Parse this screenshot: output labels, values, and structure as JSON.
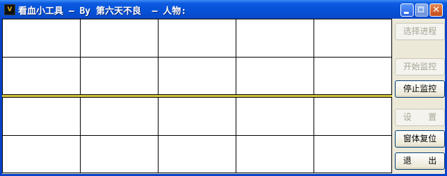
{
  "window": {
    "title": "看血小工具 — By 第六天不良  — 人物:",
    "icon_label": "V",
    "buttons": {
      "minimize": "minimize-icon",
      "maximize": "maximize-icon",
      "close": "close-icon",
      "close_glyph": "✕"
    }
  },
  "grid_top": {
    "rows": 2,
    "cols": 5
  },
  "grid_bottom": {
    "rows": 2,
    "cols": 5
  },
  "buttons": {
    "select_process": {
      "label": "选择进程",
      "enabled": false
    },
    "start_monitor": {
      "label": "开始监控",
      "enabled": false
    },
    "stop_monitor": {
      "label": "停止监控",
      "enabled": true
    },
    "settings": {
      "label": "设　　置",
      "enabled": false
    },
    "reset_window": {
      "label": "窗体复位",
      "enabled": true
    },
    "exit": {
      "label": "退　　出",
      "enabled": true
    }
  }
}
